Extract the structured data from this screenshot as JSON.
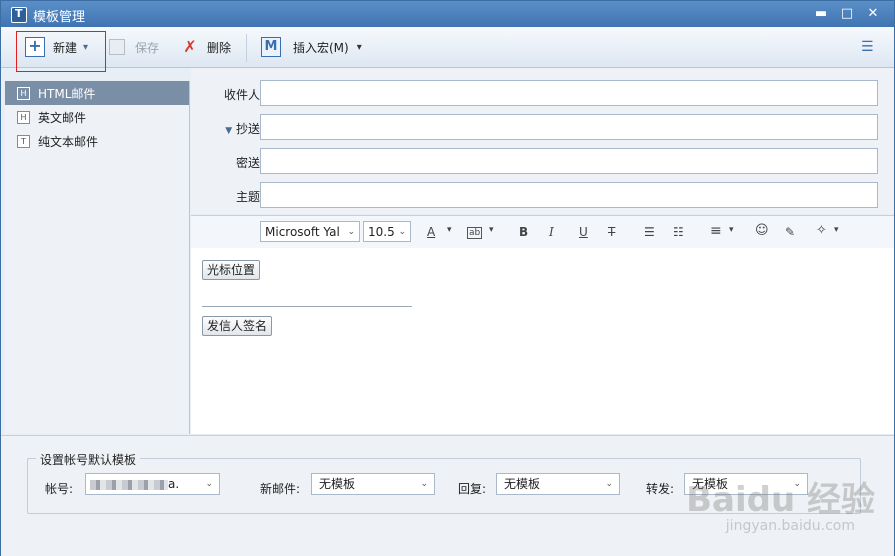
{
  "window": {
    "title": "模板管理",
    "minimize_glyph": "▬",
    "maximize_glyph": "□",
    "close_glyph": "✕"
  },
  "toolbar": {
    "new_label": "新建",
    "save_label": "保存",
    "delete_label": "删除",
    "insert_macro_label": "插入宏(M)",
    "plus_glyph": "+",
    "macro_glyph": "M",
    "dropdown_glyph": "▾",
    "list_glyph": "☰",
    "highlight_color": "#e02020"
  },
  "templates": [
    {
      "label": "HTML邮件",
      "icon": "H",
      "selected": true
    },
    {
      "label": "英文邮件",
      "icon": "H",
      "selected": false
    },
    {
      "label": "纯文本邮件",
      "icon": "T",
      "selected": false
    }
  ],
  "form": {
    "to_label": "收件人:",
    "cc_label": "抄送:",
    "cc_toggle_glyph": "▼",
    "bcc_label": "密送:",
    "subject_label": "主题:"
  },
  "format": {
    "font_family": "Microsoft Yal",
    "font_size": "10.5",
    "font_color_glyph": "A",
    "highlight_glyph": "ab",
    "bold": "B",
    "italic": "I",
    "underline": "U",
    "strike": "T",
    "bullet_glyph": "☰",
    "number_glyph": "☷",
    "align_glyph": "≡",
    "emoji_glyph": "☺",
    "clear_glyph": "✎",
    "magic_glyph": "✧"
  },
  "editor": {
    "cursor_button": "光标位置",
    "signature_button": "发信人签名"
  },
  "bottom": {
    "group_title": "设置帐号默认模板",
    "account_label": "帐号:",
    "account_value_tail": "a.",
    "new_mail_label": "新邮件:",
    "new_mail_value": "无模板",
    "reply_label": "回复:",
    "reply_value": "无模板",
    "forward_label": "转发:",
    "forward_value": "无模板",
    "arrow_glyph": "⌄"
  },
  "watermark": {
    "text": "Baidu 经验",
    "url": "jingyan.baidu.com"
  }
}
